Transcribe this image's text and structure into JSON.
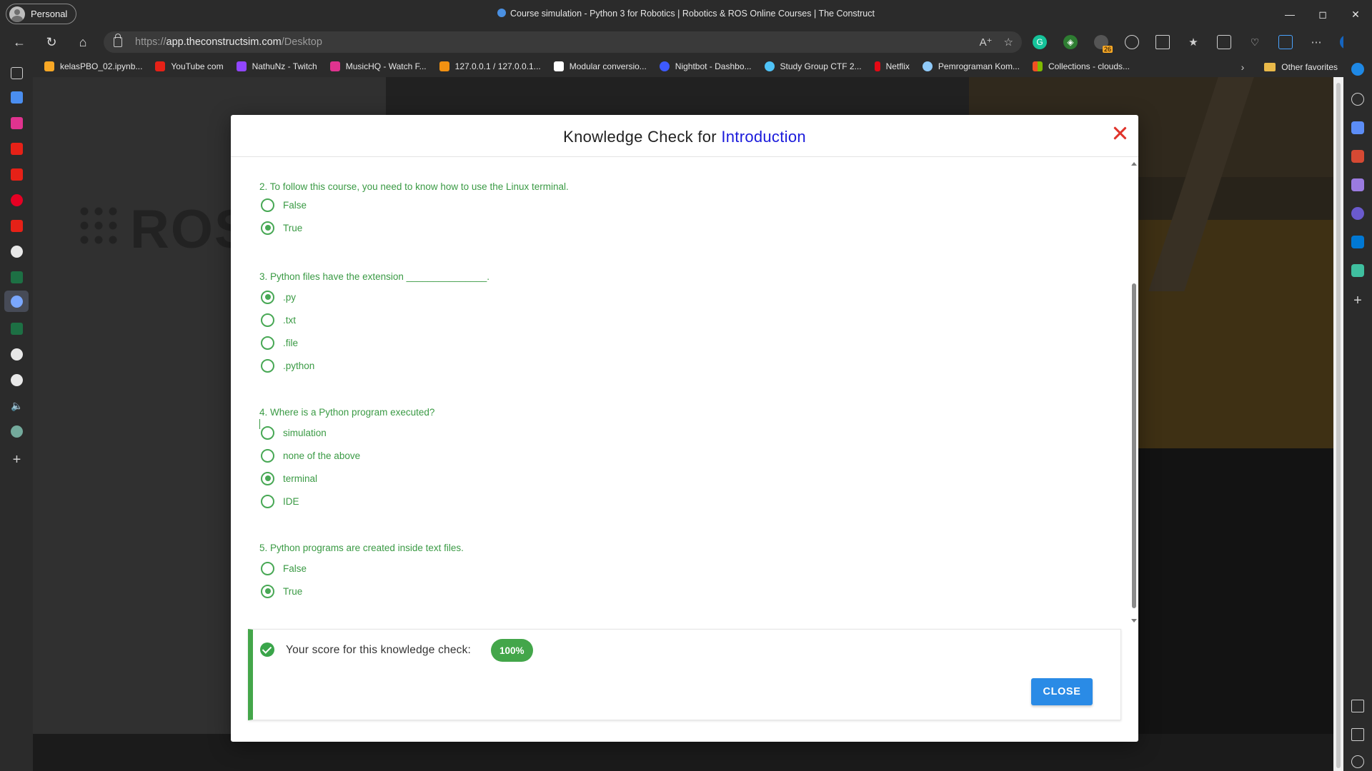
{
  "browser": {
    "profile_label": "Personal",
    "window_title": "Course simulation - Python 3 for Robotics | Robotics & ROS Online Courses | The Construct",
    "url_prefix": "https://",
    "url_host": "app.theconstructsim.com",
    "url_path": "/Desktop",
    "extension_badge": "26"
  },
  "favorites": [
    {
      "label": "kelasPBO_02.ipynb...",
      "icon": "colab-icon",
      "color": "#f9a825"
    },
    {
      "label": "YouTube com",
      "icon": "youtube-icon",
      "color": "#e62117"
    },
    {
      "label": "NathuNz - Twitch",
      "icon": "twitch-icon",
      "color": "#9146ff"
    },
    {
      "label": "MusicHQ - Watch F...",
      "icon": "play-icon",
      "color": "#e0338f"
    },
    {
      "label": "127.0.0.1 / 127.0.0.1...",
      "icon": "phpmyadmin-icon",
      "color": "#f29111"
    },
    {
      "label": "Modular conversio...",
      "icon": "grid-icon",
      "color": "#ffffff"
    },
    {
      "label": "Nightbot - Dashbo...",
      "icon": "nightbot-icon",
      "color": "#3d5afe"
    },
    {
      "label": "Study Group CTF 2...",
      "icon": "ctf-icon",
      "color": "#4fc3f7"
    },
    {
      "label": "Netflix",
      "icon": "netflix-icon",
      "color": "#e50914"
    },
    {
      "label": "Pemrograman Kom...",
      "icon": "pk-icon",
      "color": "#90caf9"
    },
    {
      "label": "Collections - clouds...",
      "icon": "windows-icon",
      "color": "#f25022"
    }
  ],
  "other_favorites_label": "Other favorites",
  "modal": {
    "title_prefix": "Knowledge Check for ",
    "title_accent": "Introduction",
    "questions": [
      {
        "text": "2. To follow this course, you need to know how to use the Linux terminal.",
        "options": [
          {
            "label": "False",
            "selected": false
          },
          {
            "label": "True",
            "selected": true
          }
        ]
      },
      {
        "text": "3. Python files have the extension _______________.",
        "options": [
          {
            "label": ".py",
            "selected": true
          },
          {
            "label": ".txt",
            "selected": false
          },
          {
            "label": ".file",
            "selected": false
          },
          {
            "label": ".python",
            "selected": false
          }
        ]
      },
      {
        "text": "4. Where is a Python program executed?",
        "options": [
          {
            "label": "simulation",
            "selected": false
          },
          {
            "label": "none of the above",
            "selected": false
          },
          {
            "label": "terminal",
            "selected": true
          },
          {
            "label": "IDE",
            "selected": false
          }
        ]
      },
      {
        "text": "5. Python programs are created inside text files.",
        "options": [
          {
            "label": "False",
            "selected": false
          },
          {
            "label": "True",
            "selected": true
          }
        ]
      }
    ],
    "score_text": "Your score for this knowledge check:",
    "score_value": "100%",
    "close_label": "CLOSE"
  },
  "colors": {
    "accent_green": "#44a64a",
    "title_accent": "#1a1adb",
    "close_button": "#2a8be6",
    "close_x": "#e0332a"
  }
}
